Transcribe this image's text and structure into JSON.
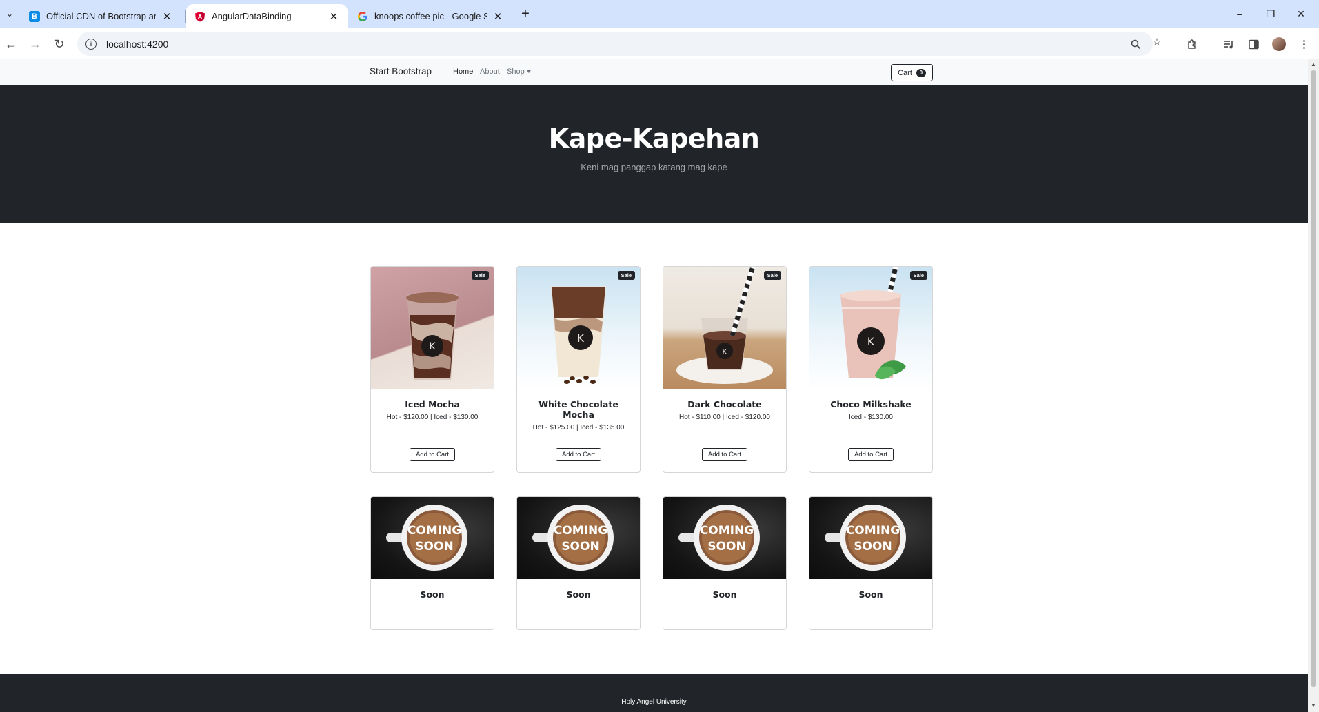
{
  "browser": {
    "tabs": [
      {
        "title": "Official CDN of Bootstrap and F",
        "icon": "bootstrap-favicon",
        "active": false
      },
      {
        "title": "AngularDataBinding",
        "icon": "angular-favicon",
        "active": true
      },
      {
        "title": "knoops coffee pic - Google Sea",
        "icon": "google-favicon",
        "active": false
      }
    ],
    "new_tab": "+",
    "url": "localhost:4200",
    "colors": {
      "tabbar": "#d3e3fd",
      "toolbar": "#ffffff"
    }
  },
  "site": {
    "brand": "Start Bootstrap",
    "nav": {
      "home": "Home",
      "about": "About",
      "shop": "Shop"
    },
    "cart": {
      "label": "Cart",
      "count": "0"
    },
    "hero": {
      "title": "Kape-Kapehan",
      "subtitle": "Keni mag panggap katang mag kape"
    },
    "products": [
      {
        "name": "Iced Mocha",
        "price": "Hot - $120.00 | Iced - $130.00",
        "badge": "Sale",
        "button": "Add to Cart"
      },
      {
        "name": "White Chocolate Mocha",
        "price": "Hot - $125.00 | Iced - $135.00",
        "badge": "Sale",
        "button": "Add to Cart"
      },
      {
        "name": "Dark Chocolate",
        "price": "Hot - $110.00 | Iced - $120.00",
        "badge": "Sale",
        "button": "Add to Cart"
      },
      {
        "name": "Choco Milkshake",
        "price": "Iced - $130.00",
        "badge": "Sale",
        "button": "Add to Cart"
      }
    ],
    "coming_soon": [
      {
        "name": "Soon",
        "image_text_1": "COMING",
        "image_text_2": "SOON"
      },
      {
        "name": "Soon",
        "image_text_1": "COMING",
        "image_text_2": "SOON"
      },
      {
        "name": "Soon",
        "image_text_1": "COMING",
        "image_text_2": "SOON"
      },
      {
        "name": "Soon",
        "image_text_1": "COMING",
        "image_text_2": "SOON"
      }
    ],
    "footer": "Holy Angel University",
    "colors": {
      "dark": "#212529",
      "light": "#f8f9fa",
      "muted": "#6c757d"
    }
  }
}
